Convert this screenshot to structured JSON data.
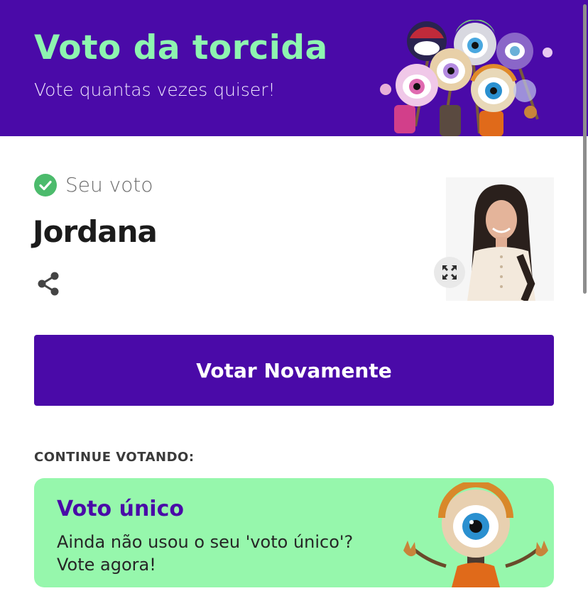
{
  "header": {
    "title": "Voto da torcida",
    "subtitle": "Vote quantas vezes quiser!",
    "background_color": "#4a0aa8",
    "title_color": "#8ef5b0",
    "art_icon": "big-eye-mascots-group"
  },
  "vote": {
    "status_label": "Seu voto",
    "status_icon": "check-circle-icon",
    "candidate_name": "Jordana",
    "share_icon": "share-icon",
    "expand_icon": "expand-icon"
  },
  "actions": {
    "vote_again_label": "Votar Novamente",
    "button_color": "#4a0aa8"
  },
  "continue_section": {
    "label": "CONTINUE VOTANDO:",
    "card": {
      "title": "Voto único",
      "text_line1": "Ainda não usou o seu 'voto único'?",
      "text_line2": "Vote agora!",
      "background_color": "#96f7ac",
      "art_icon": "big-eye-mascot"
    }
  }
}
